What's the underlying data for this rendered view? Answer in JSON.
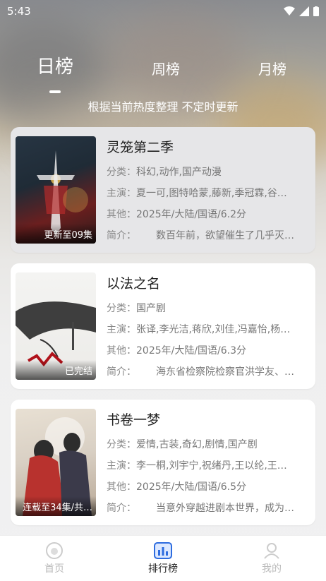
{
  "status_bar": {
    "time": "5:43"
  },
  "tabs": [
    {
      "label": "日榜",
      "active": true
    },
    {
      "label": "周榜",
      "active": false
    },
    {
      "label": "月榜",
      "active": false
    }
  ],
  "subtitle": "根据当前热度整理 不定时更新",
  "items": [
    {
      "title": "灵笼第二季",
      "badge": "更新至09集",
      "category_label": "分类：",
      "category": "科幻,动作,国产动漫",
      "cast_label": "主演：",
      "cast": "夏一可,图特哈蒙,藤新,季冠霖,谷…",
      "other_label": "其他：",
      "other": "2025年/大陆/国语/6.2分",
      "intro_label": "简介：",
      "intro": "数百年前，欲望催生了几乎灭…",
      "poster_colors": [
        "#1f2b36",
        "#b52b2b",
        "#c8a24a"
      ]
    },
    {
      "title": "以法之名",
      "badge": "已完结",
      "category_label": "分类：",
      "category": "国产剧",
      "cast_label": "主演：",
      "cast": "张译,李光洁,蒋欣,刘佳,冯嘉怡,杨…",
      "other_label": "其他：",
      "other": "2025年/大陆/国语/6.3分",
      "intro_label": "简介：",
      "intro": "海东省检察院检察官洪学友、…",
      "poster_colors": [
        "#f1f1ef",
        "#1e1e1e",
        "#b0121a"
      ]
    },
    {
      "title": "书卷一梦",
      "badge": "连载至34集/共…",
      "category_label": "分类：",
      "category": "爱情,古装,奇幻,剧情,国产剧",
      "cast_label": "主演：",
      "cast": "李一桐,刘宇宁,祝绪丹,王以纶,王…",
      "other_label": "其他：",
      "other": "2025年/大陆/国语/6.5分",
      "intro_label": "简介：",
      "intro": "当意外穿越进剧本世界，成为…",
      "poster_colors": [
        "#d9d0c4",
        "#b8322e",
        "#3b3a4a"
      ]
    }
  ],
  "nav": [
    {
      "label": "首页",
      "icon": "home-icon",
      "active": false
    },
    {
      "label": "排行榜",
      "icon": "ranking-icon",
      "active": true
    },
    {
      "label": "我的",
      "icon": "profile-icon",
      "active": false
    }
  ]
}
